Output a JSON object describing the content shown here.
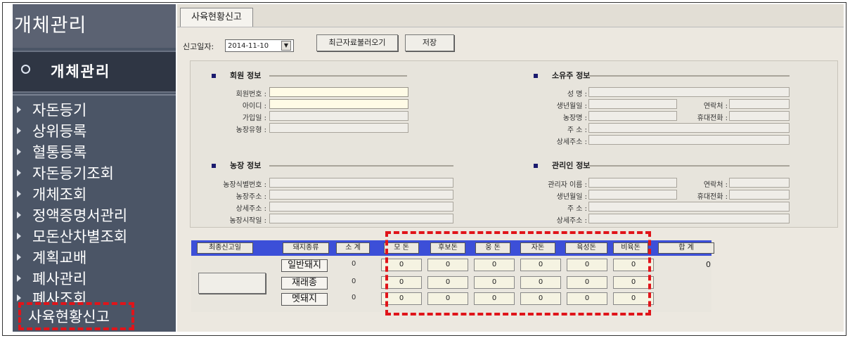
{
  "sidebar": {
    "title": "개체관리",
    "section": "개체관리",
    "items": [
      "자돈등기",
      "상위등록",
      "혈통등록",
      "자돈등기조회",
      "개체조회",
      "정액증명서관리",
      "모돈산차별조회",
      "계획교배",
      "폐사관리",
      "폐사조회"
    ],
    "active": "사육현황신고",
    "highlight_color": "#e0141a"
  },
  "tab": {
    "label": "사육현황신고"
  },
  "toolbar": {
    "date_label": "신고일자:",
    "date_value": "2014-11-10",
    "load_button": "최근자료불러오기",
    "save_button": "저장"
  },
  "member_info": {
    "title": "회원 정보",
    "fields": [
      "회원번호 :",
      "아이디 :",
      "가입일 :",
      "농장유형 :"
    ]
  },
  "owner_info": {
    "title": "소유주 정보",
    "fields": [
      "성 명 :",
      "생년월일 :",
      "농장명 :",
      "주 소 :",
      "상세주소 :"
    ],
    "right_fields": [
      "연락처 :",
      "휴대전화 :"
    ]
  },
  "farm_info": {
    "title": "농장 정보",
    "fields": [
      "농장식별번호 :",
      "농장주소 :",
      "상세주소 :",
      "농장시작일 :"
    ]
  },
  "manager_info": {
    "title": "관리인 정보",
    "fields": [
      "관리자 이름 :",
      "생년월일 :",
      "주 소 :",
      "상세주소 :"
    ],
    "right_fields": [
      "연락처 :",
      "휴대전화 :"
    ]
  },
  "grid": {
    "recent_button": "최종신고일",
    "type_header": "돼지종류",
    "subtotal_header": "소 계",
    "columns": [
      "모 돈",
      "후보돈",
      "웅 돈",
      "자돈",
      "육성돈",
      "비육돈"
    ],
    "total_header": "합 계",
    "rows": [
      {
        "label": "일반돼지",
        "subtotal": "0",
        "values": [
          "0",
          "0",
          "0",
          "0",
          "0",
          "0"
        ]
      },
      {
        "label": "재래종",
        "subtotal": "0",
        "values": [
          "0",
          "0",
          "0",
          "0",
          "0",
          "0"
        ]
      },
      {
        "label": "멧돼지",
        "subtotal": "0",
        "values": [
          "0",
          "0",
          "0",
          "0",
          "0",
          "0"
        ]
      }
    ],
    "total_value": "0"
  }
}
